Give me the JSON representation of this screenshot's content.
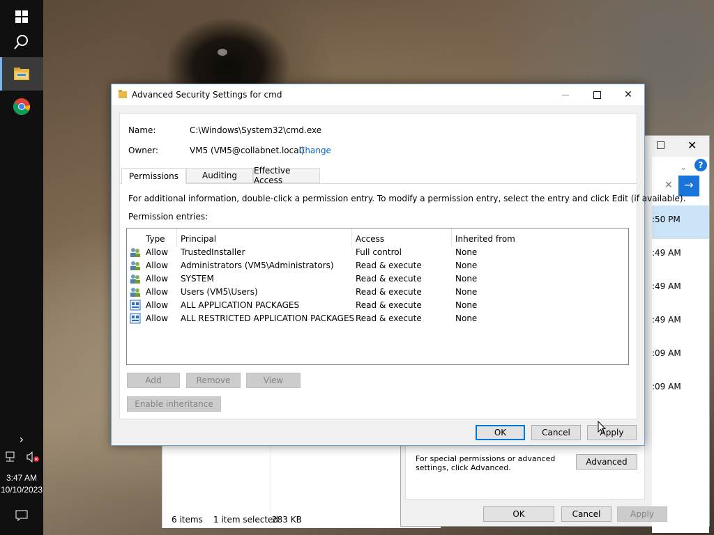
{
  "taskbar": {
    "time": "3:47 AM",
    "date": "10/10/2023"
  },
  "background_explorer": {
    "status_items": "6 items",
    "status_selected": "1 item selected",
    "status_size": "283 KB",
    "times": [
      ":50 PM",
      ":49 AM",
      ":49 AM",
      ":49 AM",
      ":09 AM",
      ":09 AM"
    ]
  },
  "background_properties": {
    "hint_text": "For special permissions or advanced settings, click Advanced.",
    "advanced_label": "Advanced",
    "ok_label": "OK",
    "cancel_label": "Cancel",
    "apply_label": "Apply"
  },
  "dialog": {
    "title": "Advanced Security Settings for cmd",
    "name_label": "Name:",
    "name_value": "C:\\Windows\\System32\\cmd.exe",
    "owner_label": "Owner:",
    "owner_value": "VM5 (VM5@collabnet.local)",
    "change_link": "Change",
    "tabs": [
      {
        "label": "Permissions",
        "selected": true
      },
      {
        "label": "Auditing",
        "selected": false
      },
      {
        "label": "Effective Access",
        "selected": false
      }
    ],
    "info_text": "For additional information, double-click a permission entry. To modify a permission entry, select the entry and click Edit (if available).",
    "entries_label": "Permission entries:",
    "columns": [
      "Type",
      "Principal",
      "Access",
      "Inherited from"
    ],
    "entries": [
      {
        "icon": "users-icon",
        "type": "Allow",
        "principal": "TrustedInstaller",
        "access": "Full control",
        "inherited": "None"
      },
      {
        "icon": "users-icon",
        "type": "Allow",
        "principal": "Administrators (VM5\\Administrators)",
        "access": "Read & execute",
        "inherited": "None"
      },
      {
        "icon": "users-icon",
        "type": "Allow",
        "principal": "SYSTEM",
        "access": "Read & execute",
        "inherited": "None"
      },
      {
        "icon": "users-icon",
        "type": "Allow",
        "principal": "Users (VM5\\Users)",
        "access": "Read & execute",
        "inherited": "None"
      },
      {
        "icon": "app-packages-icon",
        "type": "Allow",
        "principal": "ALL APPLICATION PACKAGES",
        "access": "Read & execute",
        "inherited": "None"
      },
      {
        "icon": "app-packages-icon",
        "type": "Allow",
        "principal": "ALL RESTRICTED APPLICATION PACKAGES",
        "access": "Read & execute",
        "inherited": "None"
      }
    ],
    "buttons": {
      "add": "Add",
      "remove": "Remove",
      "view": "View",
      "enable_inheritance": "Enable inheritance",
      "ok": "OK",
      "cancel": "Cancel",
      "apply": "Apply"
    }
  }
}
